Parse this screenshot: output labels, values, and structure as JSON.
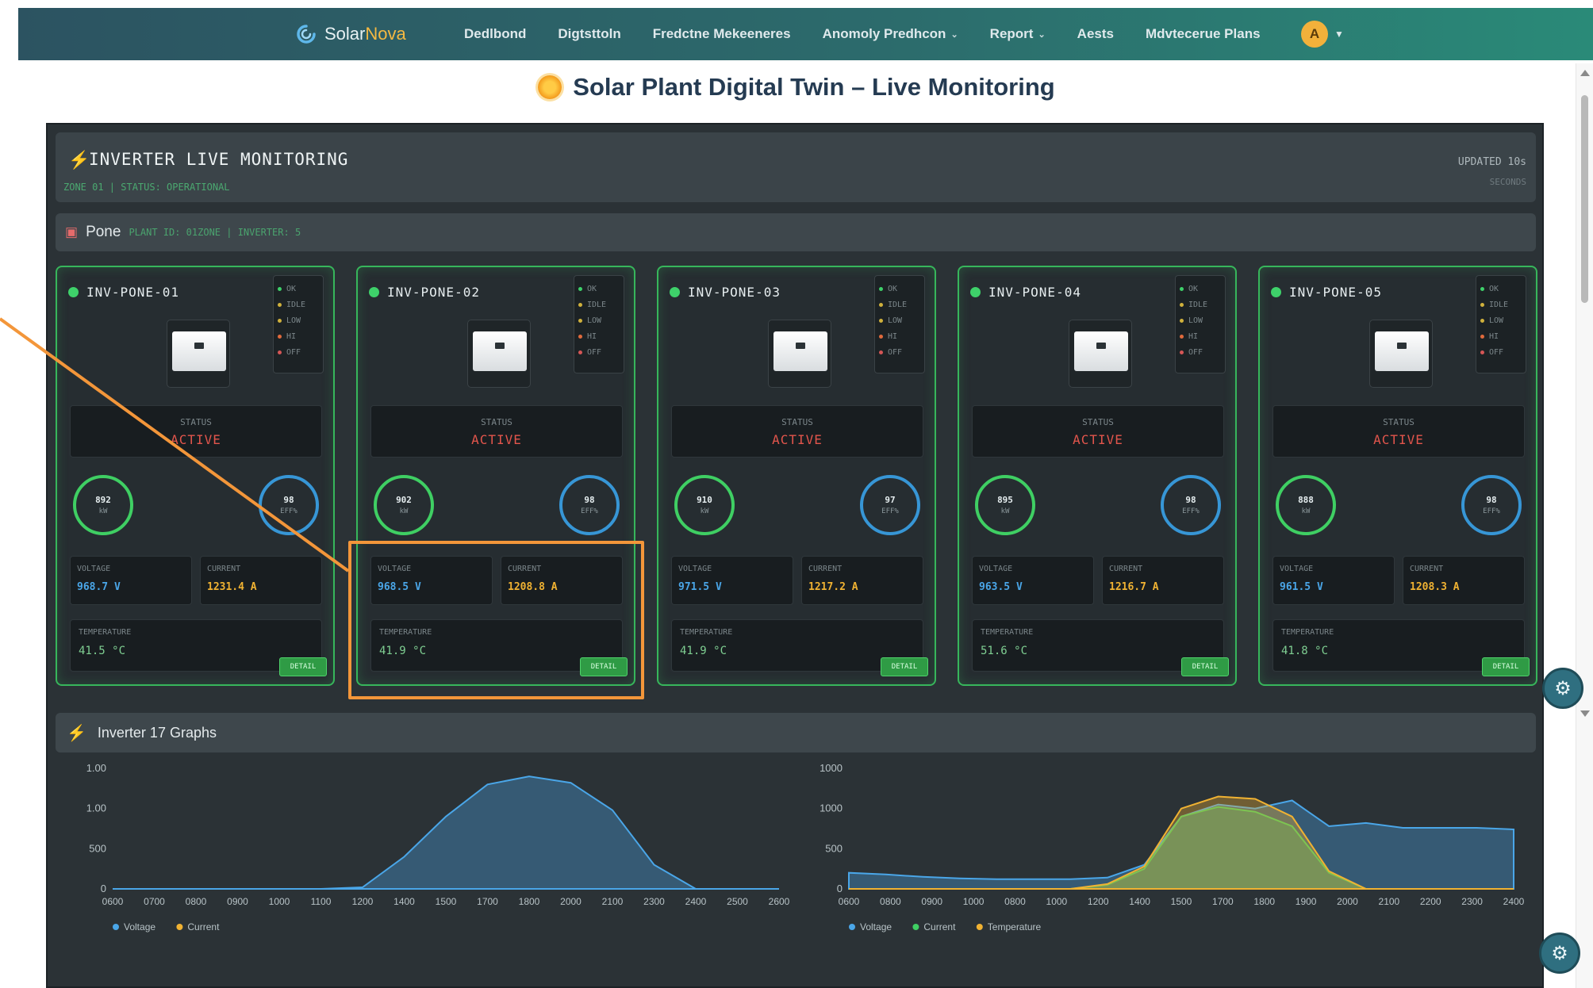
{
  "navbar": {
    "brand_prefix": "Solar",
    "brand_suffix": "Nova",
    "items": [
      {
        "label": "Dedlbond",
        "caret": false
      },
      {
        "label": "Digtsttoln",
        "caret": false
      },
      {
        "label": "Fredctne Mekeeneres",
        "caret": false
      },
      {
        "label": "Anomoly Predhcon",
        "caret": true
      },
      {
        "label": "Report",
        "caret": true
      },
      {
        "label": "Aests",
        "caret": false
      },
      {
        "label": "Mdvtecerue Plans",
        "caret": false
      }
    ],
    "avatar_initial": "A"
  },
  "page": {
    "title": "Solar Plant Digital Twin – Live Monitoring"
  },
  "section": {
    "title": "INVERTER LIVE MONITORING",
    "subtitle": "ZONE 01 | STATUS: OPERATIONAL",
    "right_top": "UPDATED 10s",
    "right_bottom": "SECONDS"
  },
  "zone": {
    "name": "Pone",
    "subtitle": "PLANT ID: 01ZONE | INVERTER: 5"
  },
  "inverters": [
    {
      "name": "INV-PONE-01",
      "status_label": "STATUS",
      "status": "ACTIVE",
      "gauge1_value": "892",
      "gauge1_unit": "kW",
      "gauge2_value": "98",
      "gauge2_unit": "EFF%",
      "voltage_label": "VOLTAGE",
      "voltage": "968.7 V",
      "current_label": "CURRENT",
      "current": "1231.4 A",
      "temp_label": "TEMPERATURE",
      "temp": "41.5 °C",
      "button": "DETAIL",
      "legend": [
        "OK",
        "IDLE",
        "LOW",
        "HI",
        "OFF"
      ]
    },
    {
      "name": "INV-PONE-02",
      "status_label": "STATUS",
      "status": "ACTIVE",
      "gauge1_value": "902",
      "gauge1_unit": "kW",
      "gauge2_value": "98",
      "gauge2_unit": "EFF%",
      "voltage_label": "VOLTAGE",
      "voltage": "968.5 V",
      "current_label": "CURRENT",
      "current": "1208.8 A",
      "temp_label": "TEMPERATURE",
      "temp": "41.9 °C",
      "button": "DETAIL",
      "legend": [
        "OK",
        "IDLE",
        "LOW",
        "HI",
        "OFF"
      ]
    },
    {
      "name": "INV-PONE-03",
      "status_label": "STATUS",
      "status": "ACTIVE",
      "gauge1_value": "910",
      "gauge1_unit": "kW",
      "gauge2_value": "97",
      "gauge2_unit": "EFF%",
      "voltage_label": "VOLTAGE",
      "voltage": "971.5 V",
      "current_label": "CURRENT",
      "current": "1217.2 A",
      "temp_label": "TEMPERATURE",
      "temp": "41.9 °C",
      "button": "DETAIL",
      "legend": [
        "OK",
        "IDLE",
        "LOW",
        "HI",
        "OFF"
      ]
    },
    {
      "name": "INV-PONE-04",
      "status_label": "STATUS",
      "status": "ACTIVE",
      "gauge1_value": "895",
      "gauge1_unit": "kW",
      "gauge2_value": "98",
      "gauge2_unit": "EFF%",
      "voltage_label": "VOLTAGE",
      "voltage": "963.5 V",
      "current_label": "CURRENT",
      "current": "1216.7 A",
      "temp_label": "TEMPERATURE",
      "temp": "51.6 °C",
      "button": "DETAIL",
      "legend": [
        "OK",
        "IDLE",
        "LOW",
        "HI",
        "OFF"
      ]
    },
    {
      "name": "INV-PONE-05",
      "status_label": "STATUS",
      "status": "ACTIVE",
      "gauge1_value": "888",
      "gauge1_unit": "kW",
      "gauge2_value": "98",
      "gauge2_unit": "EFF%",
      "voltage_label": "VOLTAGE",
      "voltage": "961.5 V",
      "current_label": "CURRENT",
      "current": "1208.3 A",
      "temp_label": "TEMPERATURE",
      "temp": "41.8 °C",
      "button": "DETAIL",
      "legend": [
        "OK",
        "IDLE",
        "LOW",
        "HI",
        "OFF"
      ]
    }
  ],
  "graphs": {
    "title": "Inverter 17 Graphs"
  },
  "colors": {
    "accent_green": "#37b65b",
    "voltage_blue": "#4aa6e8",
    "current_yellow": "#f0b232",
    "highlight_orange": "#f3963a"
  },
  "chart_data": [
    {
      "type": "area",
      "title": "",
      "xlabel": "",
      "ylabel": "",
      "y_tick_labels": [
        "0",
        "500",
        "1.00",
        "1.00"
      ],
      "ylim": [
        0,
        1500
      ],
      "x": [
        "0600",
        "0700",
        "0800",
        "0900",
        "1000",
        "1100",
        "1200",
        "1300",
        "1400",
        "1500",
        "1600",
        "1700",
        "1800",
        "1900",
        "2000",
        "2100",
        "2200"
      ],
      "x_tick_labels": [
        "0600",
        "0700",
        "0800",
        "0900",
        "1000",
        "1100",
        "1200",
        "1400",
        "1500",
        "1700",
        "1800",
        "2000",
        "2100",
        "2300",
        "2400",
        "2500",
        "2600"
      ],
      "series": [
        {
          "name": "Voltage",
          "color": "#4aa6e8",
          "values": [
            0,
            0,
            0,
            0,
            0,
            0,
            20,
            400,
            900,
            1300,
            1400,
            1320,
            980,
            300,
            0,
            0,
            0
          ]
        },
        {
          "name": "Current",
          "color": "#f0b232",
          "values": []
        }
      ],
      "legend": "bottom-left"
    },
    {
      "type": "area",
      "title": "",
      "xlabel": "",
      "ylabel": "",
      "y_tick_labels": [
        "0",
        "500",
        "1000",
        "1000"
      ],
      "ylim": [
        0,
        1500
      ],
      "x": [
        "0600",
        "0700",
        "0800",
        "0900",
        "1000",
        "1100",
        "1200",
        "1300",
        "1400",
        "1500",
        "1600",
        "1700",
        "1800",
        "1900",
        "2000",
        "2100",
        "2200",
        "2300",
        "2400"
      ],
      "x_tick_labels": [
        "0600",
        "0800",
        "0900",
        "1000",
        "0800",
        "1000",
        "1200",
        "1400",
        "1500",
        "1700",
        "1800",
        "1900",
        "2000",
        "2100",
        "2200",
        "2300",
        "2400"
      ],
      "series": [
        {
          "name": "Voltage",
          "color": "#4aa6e8",
          "values": [
            200,
            180,
            150,
            130,
            120,
            120,
            120,
            140,
            300,
            900,
            1050,
            1000,
            1100,
            780,
            820,
            760,
            760,
            760,
            740
          ]
        },
        {
          "name": "Current",
          "color": "#3fcf63",
          "values": [
            0,
            0,
            0,
            0,
            0,
            0,
            0,
            50,
            250,
            900,
            1020,
            960,
            780,
            200,
            0,
            0,
            0,
            0,
            0
          ]
        },
        {
          "name": "Temperature",
          "color": "#f0b232",
          "values": [
            0,
            0,
            0,
            0,
            0,
            0,
            0,
            60,
            280,
            1000,
            1150,
            1120,
            900,
            220,
            0,
            0,
            0,
            0,
            0
          ]
        }
      ],
      "legend": "bottom-left"
    }
  ]
}
